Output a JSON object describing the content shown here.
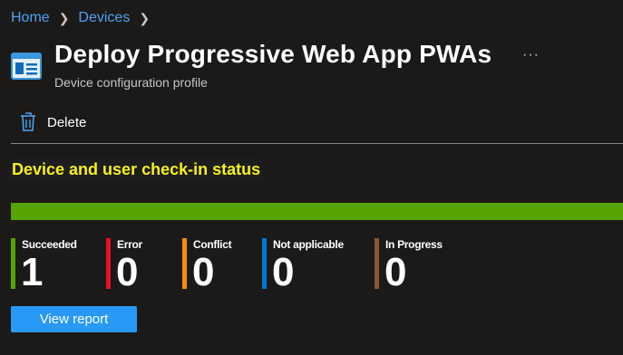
{
  "breadcrumb": {
    "items": [
      "Home",
      "Devices"
    ]
  },
  "header": {
    "title": "Deploy Progressive Web App PWAs",
    "subtitle": "Device configuration profile",
    "more_label": "···"
  },
  "toolbar": {
    "delete_label": "Delete"
  },
  "section": {
    "title": "Device and user check-in status"
  },
  "status": {
    "bar_color": "#57a300",
    "succeeded_fraction": 1.0,
    "stats": [
      {
        "label": "Succeeded",
        "value": "1",
        "color": "#57a300"
      },
      {
        "label": "Error",
        "value": "0",
        "color": "#e81123"
      },
      {
        "label": "Conflict",
        "value": "0",
        "color": "#ff8c00"
      },
      {
        "label": "Not applicable",
        "value": "0",
        "color": "#0078d4"
      },
      {
        "label": "In Progress",
        "value": "0",
        "color": "#8e562e"
      }
    ]
  },
  "actions": {
    "view_report_label": "View report"
  },
  "colors": {
    "accent": "#2899f5",
    "highlight_text": "#f7f11a",
    "link": "#4aa3f0"
  }
}
